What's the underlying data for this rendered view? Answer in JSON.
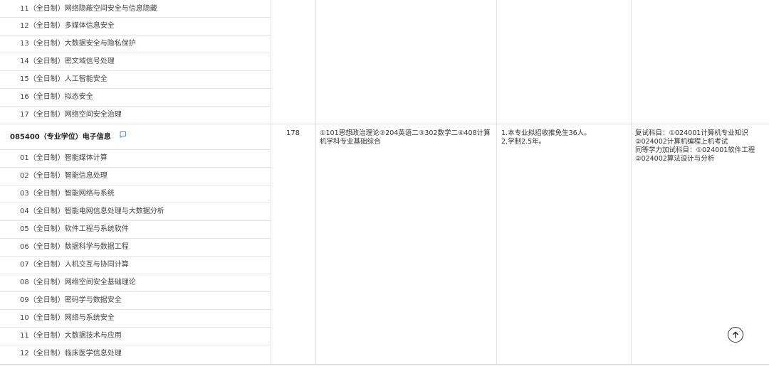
{
  "rows_top": [
    "11（全日制）网络隐蔽空间安全与信息隐藏",
    "12（全日制）多媒体信息安全",
    "13（全日制）大数据安全与隐私保护",
    "14（全日制）密文域信号处理",
    "15（全日制）人工智能安全",
    "16（全日制）拟态安全",
    "17（全日制）网络空间安全治理"
  ],
  "major": {
    "title": "085400（专业学位）电子信息",
    "flag_icon": "flag-icon",
    "count": "178",
    "exam_subjects": [
      "①101思想政治理论②204英语二③302数学二④408计算",
      "机学科专业基础综合"
    ],
    "notes": [
      "1.本专业拟招收推免生36人。",
      "2.学制2.5年。"
    ],
    "retest": [
      "复试科目：①024001计算机专业知识",
      "②024002计算机编程上机考试",
      "同等学力加试科目：①024001软件工程",
      "②024002算法设计与分析"
    ]
  },
  "rows_bottom": [
    "01（全日制）智能媒体计算",
    "02（全日制）智能信息处理",
    "03（全日制）智能网络与系统",
    "04（全日制）智能电网信息处理与大数据分析",
    "05（全日制）软件工程与系统软件",
    "06（全日制）数据科学与数据工程",
    "07（全日制）人机交互与协同计算",
    "08（全日制）网络空间安全基础理论",
    "09（全日制）密码学与数据安全",
    "10（全日制）网络与系统安全",
    "11（全日制）大数据技术与应用",
    "12（全日制）临床医学信息处理"
  ],
  "scroll_top_icon": "arrow-up-circle-icon",
  "colors": {
    "border": "#e4e4e4",
    "flag": "#4a8fe7",
    "text": "#333333"
  }
}
